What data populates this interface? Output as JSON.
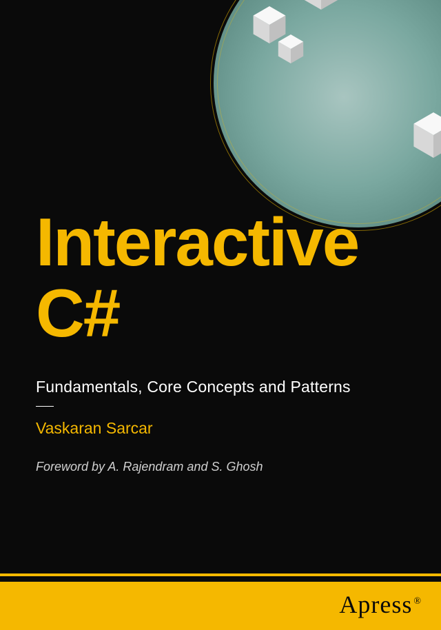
{
  "cover": {
    "title_line1": "Interactive",
    "title_line2": "C#",
    "subtitle": "Fundamentals, Core Concepts and Patterns",
    "author": "Vaskaran Sarcar",
    "foreword": "Foreword by A. Rajendram and S. Ghosh",
    "publisher": "Apress",
    "colors": {
      "accent": "#f5b800",
      "background": "#0a0a0a",
      "art_teal": "#7aa8a0",
      "text_light": "#ffffff"
    }
  }
}
